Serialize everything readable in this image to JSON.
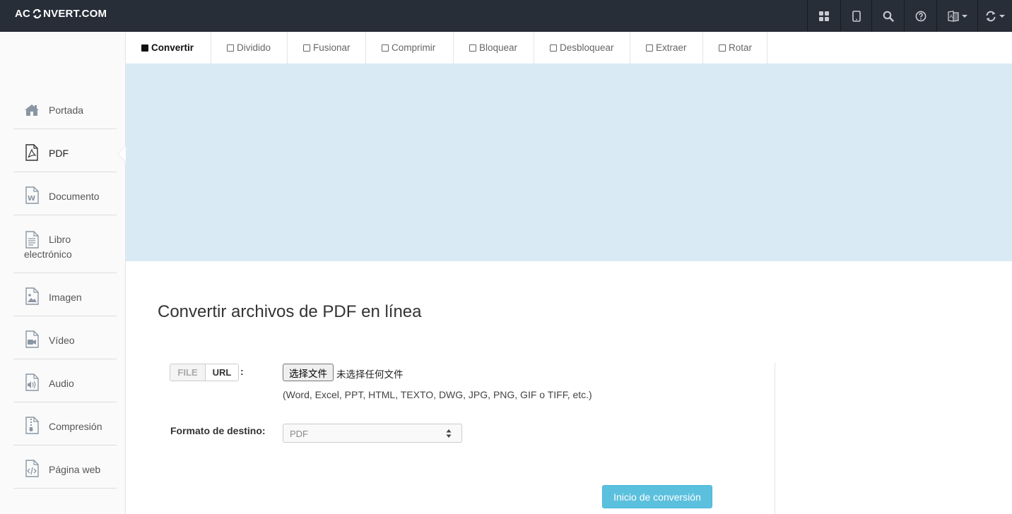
{
  "header": {
    "logo_left": "AC",
    "logo_right": "NVERT.COM",
    "icons": [
      "apps-icon",
      "tablet-icon",
      "search-icon",
      "help-icon",
      "language-icon",
      "refresh-icon"
    ]
  },
  "sidebar": {
    "items": [
      {
        "label": "Portada",
        "icon": "home-icon"
      },
      {
        "label": "PDF",
        "icon": "pdf-icon",
        "active": true
      },
      {
        "label": "Documento",
        "icon": "document-icon"
      },
      {
        "label": "Libro electrónico",
        "label_line1": "Libro",
        "label_line2": "electrónico",
        "icon": "ebook-icon"
      },
      {
        "label": "Imagen",
        "icon": "image-icon"
      },
      {
        "label": "Vídeo",
        "icon": "video-icon"
      },
      {
        "label": "Audio",
        "icon": "audio-icon"
      },
      {
        "label": "Compresión",
        "icon": "archive-icon"
      },
      {
        "label": "Página web",
        "icon": "webpage-icon"
      }
    ]
  },
  "tabs": [
    {
      "label": "Convertir",
      "active": true
    },
    {
      "label": "Dividido"
    },
    {
      "label": "Fusionar"
    },
    {
      "label": "Comprimir"
    },
    {
      "label": "Bloquear"
    },
    {
      "label": "Desbloquear"
    },
    {
      "label": "Extraer"
    },
    {
      "label": "Rotar"
    }
  ],
  "main": {
    "title": "Convertir archivos de PDF en línea",
    "source_toggle": {
      "file": "FILE",
      "url": "URL",
      "selected": "URL"
    },
    "colon": ":",
    "file_button": "选择文件",
    "file_status": "未选择任何文件",
    "formats_hint": "(Word, Excel, PPT, HTML, TEXTO, DWG, JPG, PNG, GIF o TIFF, etc.)",
    "target_label": "Formato de destino:",
    "target_value": "PDF",
    "submit": "Inicio de conversión"
  },
  "colors": {
    "topbar": "#272e38",
    "ad_background": "#daeaf4",
    "primary_button": "#5bc0de"
  }
}
